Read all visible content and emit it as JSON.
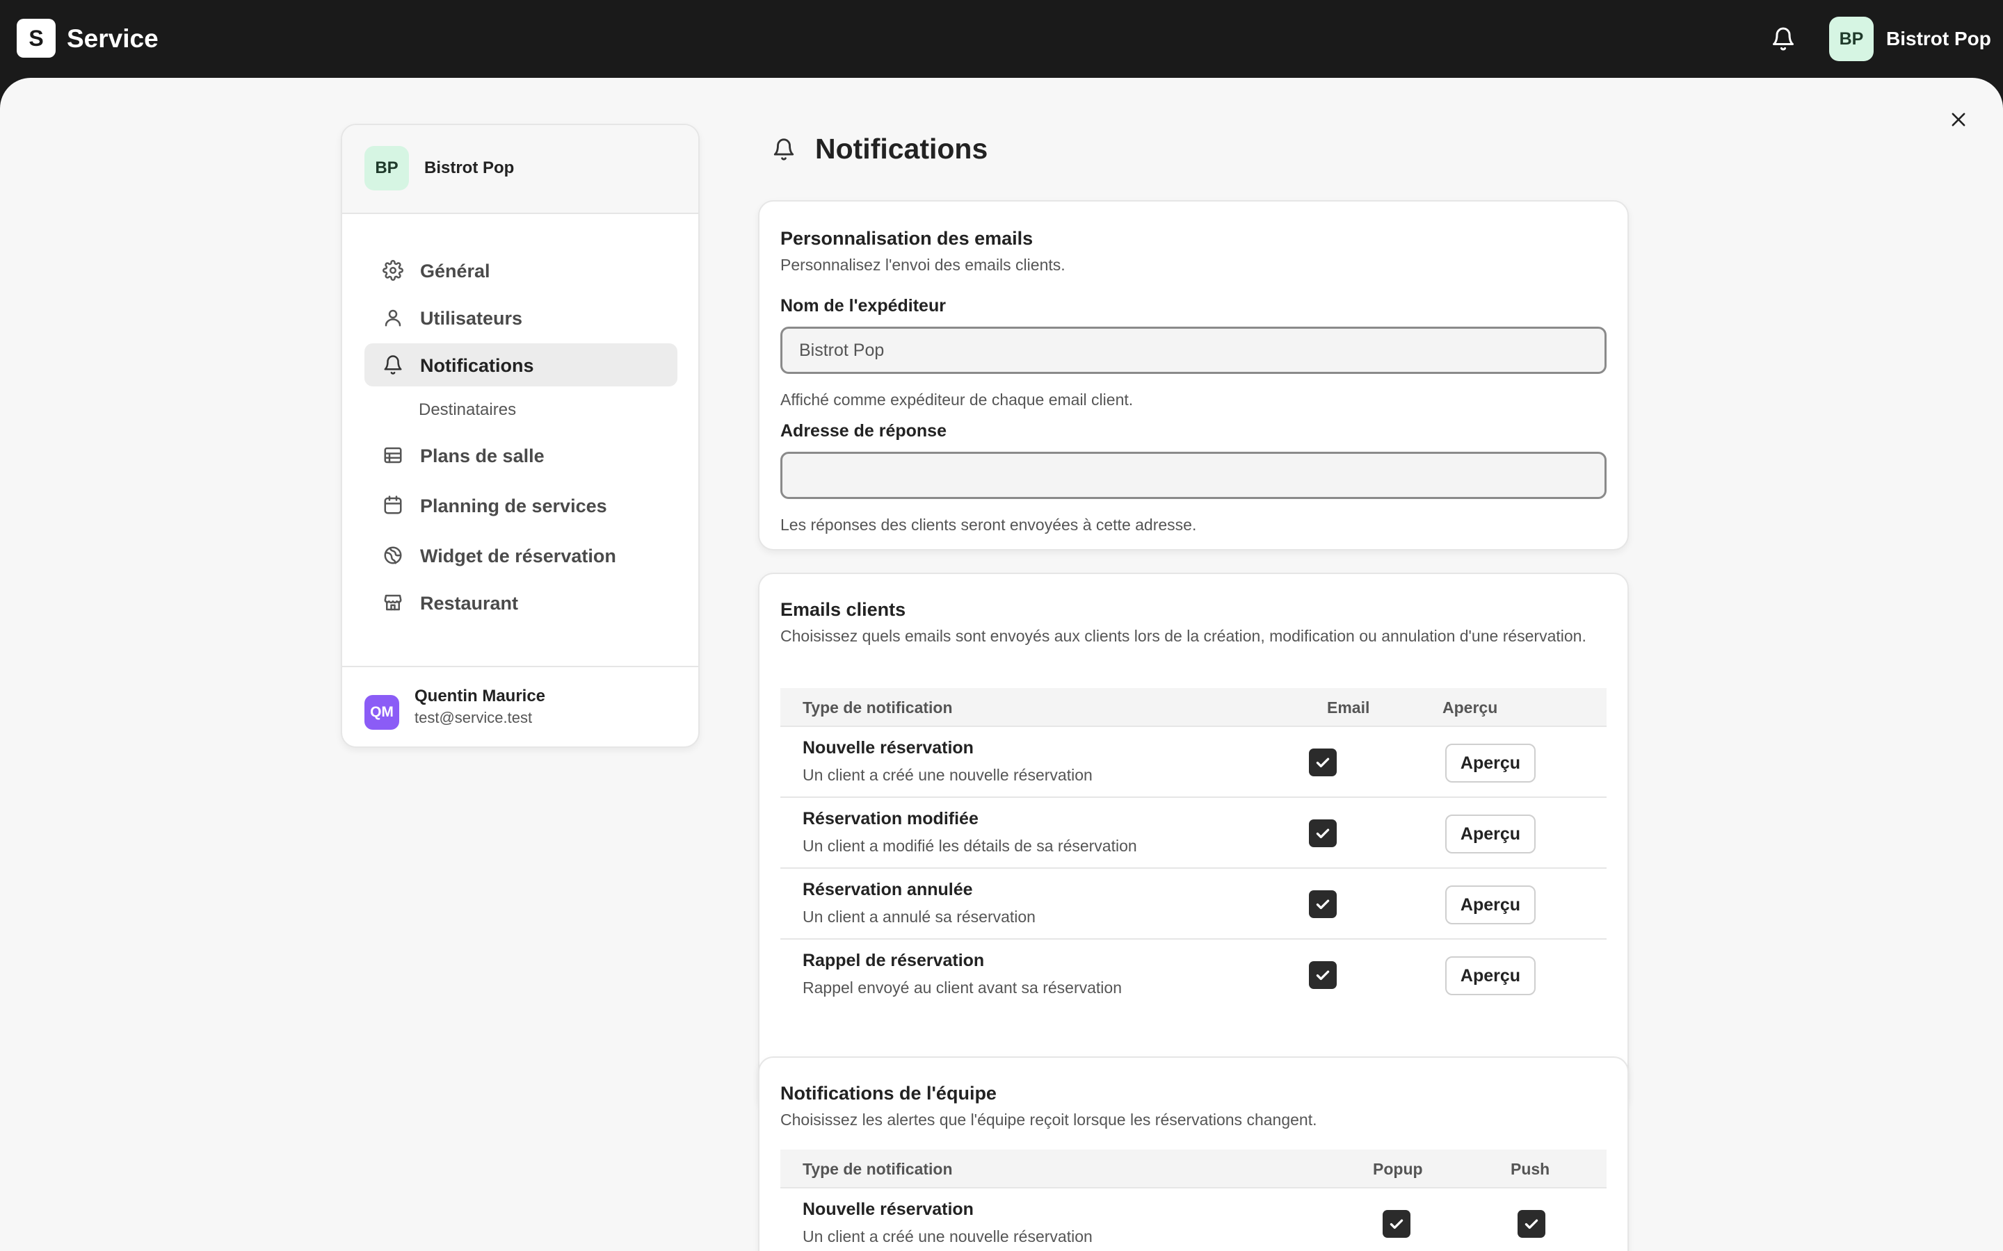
{
  "app": {
    "logo_letter": "S",
    "name": "Service"
  },
  "topbar": {
    "avatar_initials": "BP",
    "account_name": "Bistrot Pop",
    "bell_icon": "bell-icon"
  },
  "sidebar": {
    "org_initials": "BP",
    "org_name": "Bistrot Pop",
    "items": [
      {
        "label": "Général",
        "icon": "gear-icon"
      },
      {
        "label": "Utilisateurs",
        "icon": "user-icon"
      },
      {
        "label": "Notifications",
        "icon": "bell-icon",
        "active": true
      },
      {
        "label": "Destinataires"
      },
      {
        "label": "Plans de salle",
        "icon": "floor-plan-icon"
      },
      {
        "label": "Planning de services",
        "icon": "calendar-icon"
      },
      {
        "label": "Widget de réservation",
        "icon": "globe-icon"
      },
      {
        "label": "Restaurant",
        "icon": "store-icon"
      }
    ],
    "user": {
      "initials": "QM",
      "name": "Quentin Maurice",
      "email": "test@service.test"
    }
  },
  "page": {
    "title": "Notifications"
  },
  "email_settings": {
    "title": "Personnalisation des emails",
    "description": "Personnalisez l'envoi des emails clients.",
    "sender_label": "Nom de l'expéditeur",
    "sender_placeholder": "Bistrot Pop",
    "sender_help": "Affiché comme expéditeur de chaque email client.",
    "reply_label": "Adresse de réponse",
    "reply_value": "",
    "reply_help": "Les réponses des clients seront envoyées à cette adresse."
  },
  "client_emails": {
    "title": "Emails clients",
    "description": "Choisissez quels emails sont envoyés aux clients lors de la création, modification ou annulation d'une réservation.",
    "columns": [
      "Type de notification",
      "Email",
      "Aperçu"
    ],
    "rows": [
      {
        "title": "Nouvelle réservation",
        "description": "Un client a créé une nouvelle réservation",
        "email": true,
        "preview_label": "Aperçu"
      },
      {
        "title": "Réservation modifiée",
        "description": "Un client a modifié les détails de sa réservation",
        "email": true,
        "preview_label": "Aperçu"
      },
      {
        "title": "Réservation annulée",
        "description": "Un client a annulé sa réservation",
        "email": true,
        "preview_label": "Aperçu"
      },
      {
        "title": "Rappel de réservation",
        "description": "Rappel envoyé au client avant sa réservation",
        "email": true,
        "preview_label": "Aperçu"
      }
    ]
  },
  "team_notifications": {
    "title": "Notifications de l'équipe",
    "description": "Choisissez les alertes que l'équipe reçoit lorsque les réservations changent.",
    "columns": [
      "Type de notification",
      "Popup",
      "Push"
    ],
    "rows": [
      {
        "title": "Nouvelle réservation",
        "description": "Un client a créé une nouvelle réservation",
        "popup": true,
        "push": true
      }
    ]
  },
  "colors": {
    "topbar": "#1a1a1a",
    "panel": "#f7f7f7",
    "avatar_green": "#d6f5e3",
    "user_avatar": "#8b5cf6",
    "checkbox": "#2b2b2b"
  }
}
